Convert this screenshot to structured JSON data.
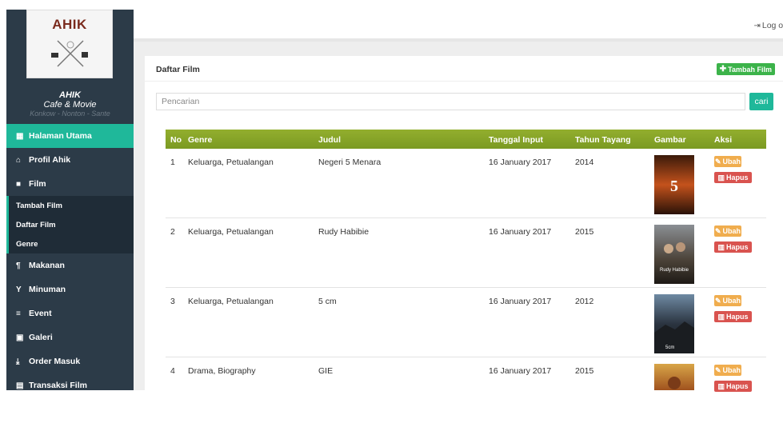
{
  "brand": {
    "logo_text": "AHIK",
    "name_line1": "AHIK",
    "name_line2": "Cafe & Movie",
    "tagline": "Konkow - Nonton - Sante"
  },
  "sidebar": {
    "items": [
      {
        "label": "Halaman Utama",
        "icon": "grid-icon",
        "glyph": "▦",
        "active": true
      },
      {
        "label": "Profil Ahik",
        "icon": "home-icon",
        "glyph": "⌂"
      },
      {
        "label": "Film",
        "icon": "video-camera-icon",
        "glyph": "■"
      },
      {
        "label": "Makanan",
        "icon": "cutlery-icon",
        "glyph": "¶"
      },
      {
        "label": "Minuman",
        "icon": "glass-icon",
        "glyph": "Y"
      },
      {
        "label": "Event",
        "icon": "list-icon",
        "glyph": "≡"
      },
      {
        "label": "Galeri",
        "icon": "picture-icon",
        "glyph": "▣"
      },
      {
        "label": "Order Masuk",
        "icon": "download-icon",
        "glyph": "⤓"
      },
      {
        "label": "Transaksi Film",
        "icon": "calendar-icon",
        "glyph": "▤"
      }
    ],
    "film_sub": [
      "Tambah Film",
      "Daftar Film",
      "Genre"
    ]
  },
  "topbar": {
    "logout_label": "Log ou"
  },
  "panel": {
    "title": "Daftar Film",
    "add_label": "Tambah Film",
    "search_placeholder": "Pencarian",
    "search_button": "cari"
  },
  "table": {
    "headers": [
      "No",
      "Genre",
      "Judul",
      "Tanggal Input",
      "Tahun Tayang",
      "Gambar",
      "Aksi"
    ],
    "edit_label": "Ubah",
    "delete_label": "Hapus",
    "rows": [
      {
        "no": "1",
        "genre": "Keluarga, Petualangan",
        "judul": "Negeri 5 Menara",
        "tanggal": "16 January 2017",
        "tahun": "2014",
        "poster_text": "5"
      },
      {
        "no": "2",
        "genre": "Keluarga, Petualangan",
        "judul": "Rudy Habibie",
        "tanggal": "16 January 2017",
        "tahun": "2015",
        "poster_text": "Rudy Habibie"
      },
      {
        "no": "3",
        "genre": "Keluarga, Petualangan",
        "judul": "5 cm",
        "tanggal": "16 January 2017",
        "tahun": "2012",
        "poster_text": "5cm"
      },
      {
        "no": "4",
        "genre": "Drama, Biography",
        "judul": "GIE",
        "tanggal": "16 January 2017",
        "tahun": "2015",
        "poster_text": ""
      }
    ]
  },
  "colors": {
    "sidebar": "#2c3b48",
    "accent": "#1fb89a",
    "table_header": "#8aa62a",
    "success": "#3cb34a",
    "warning": "#f0ad4e",
    "danger": "#d9534f"
  }
}
